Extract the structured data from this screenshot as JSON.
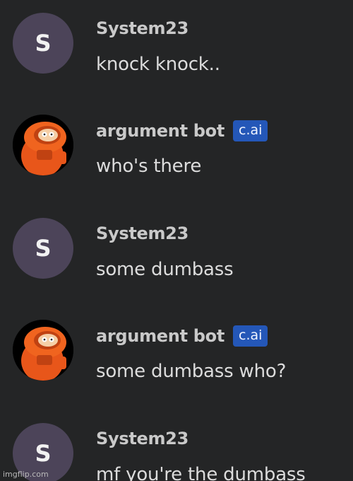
{
  "messages": [
    {
      "author": "System23",
      "avatar_initial": "S",
      "text": "knock knock.."
    },
    {
      "author": "argument bot",
      "badge": "c.ai",
      "text": "who's there"
    },
    {
      "author": "System23",
      "avatar_initial": "S",
      "text": "some dumbass"
    },
    {
      "author": "argument bot",
      "badge": "c.ai",
      "text": "some dumbass who?"
    },
    {
      "author": "System23",
      "avatar_initial": "S",
      "text": "mf you're the dumbass"
    }
  ],
  "watermark": "imgflip.com",
  "colors": {
    "background": "#242526",
    "user_avatar": "#4c4459",
    "badge": "#2457b8",
    "bot_avatar_orange": "#f0601c"
  },
  "icons": {
    "bot_avatar": "orange-hooded-character-avatar"
  }
}
